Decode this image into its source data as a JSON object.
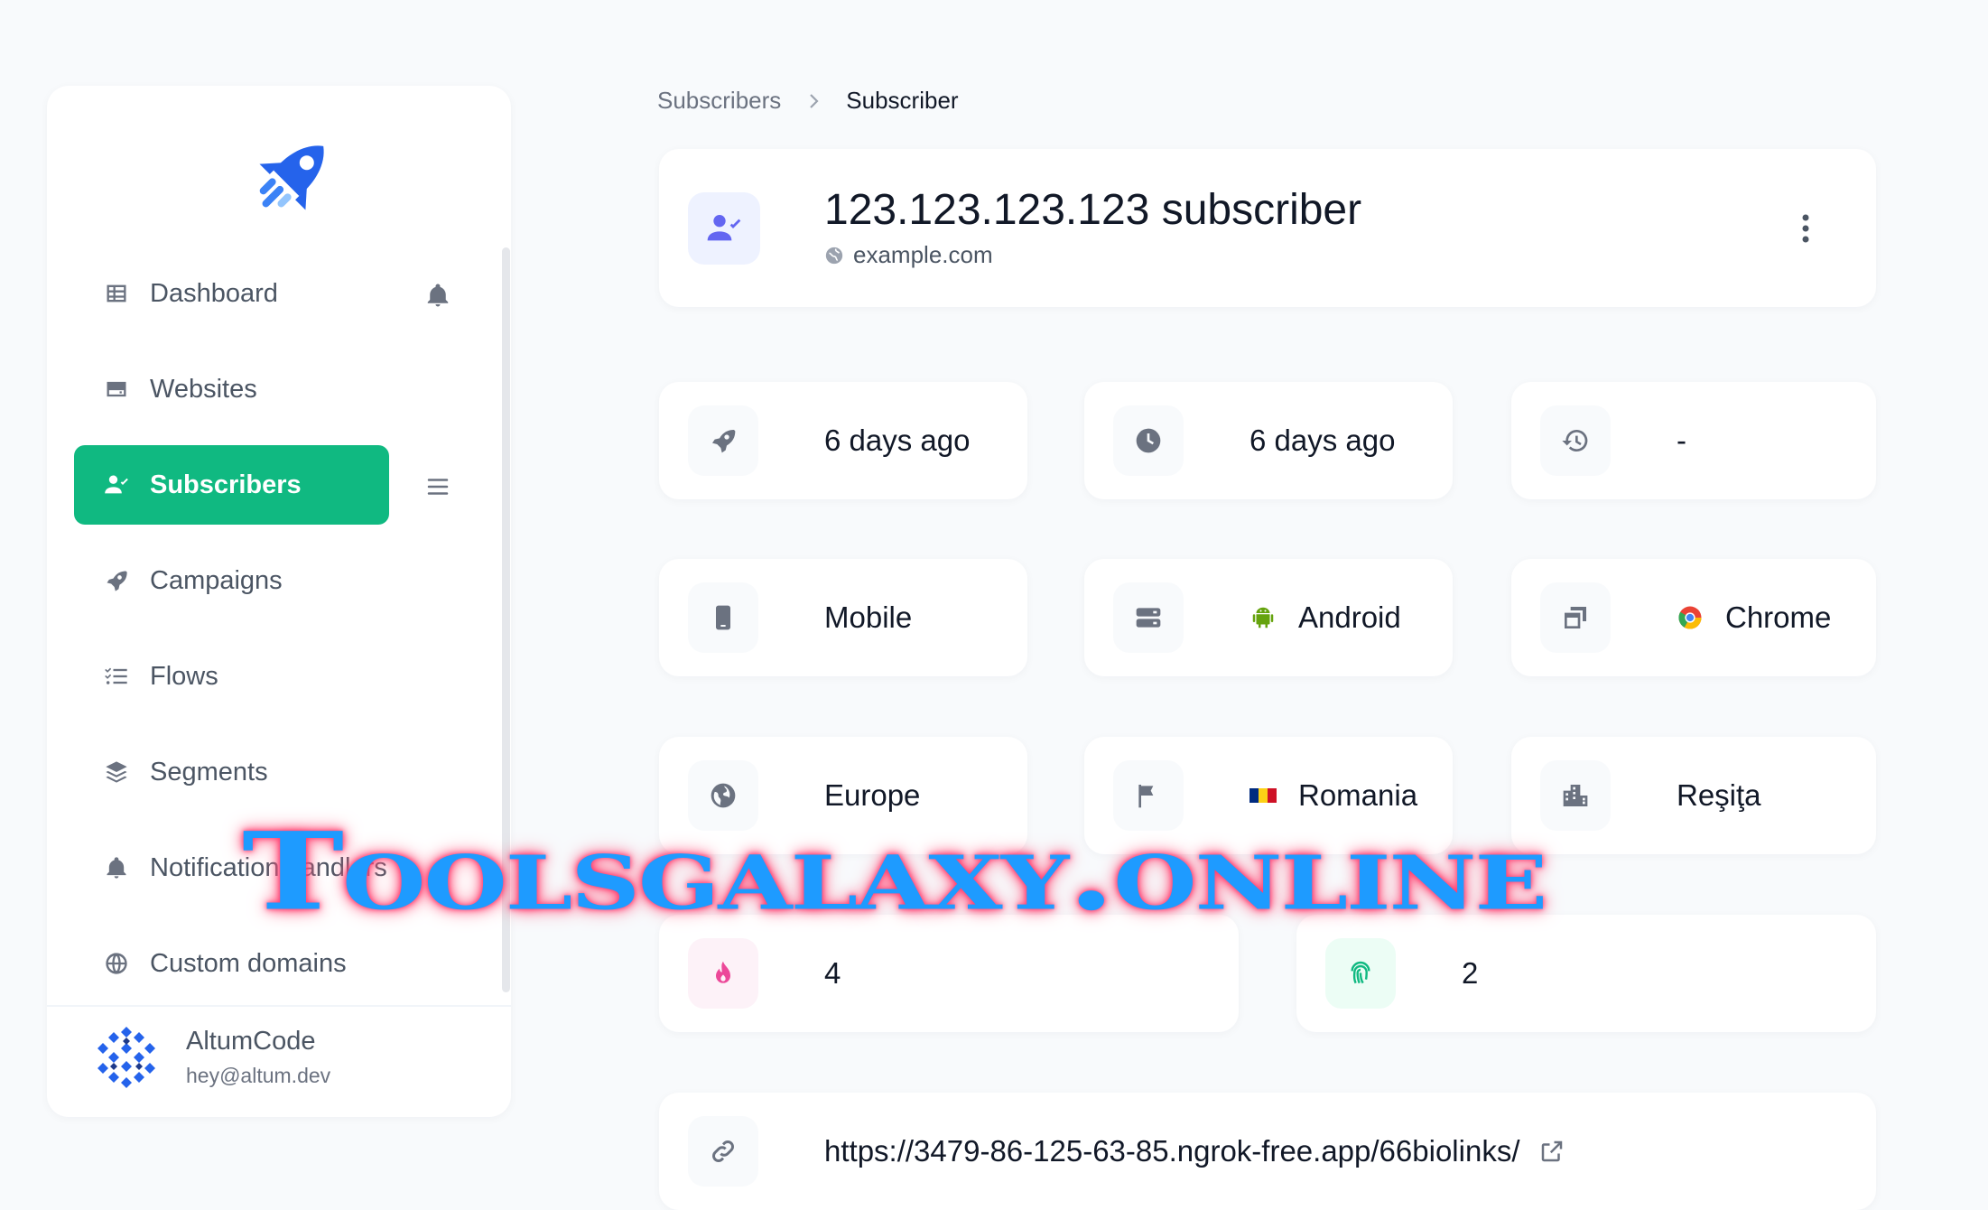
{
  "sidebar": {
    "items": [
      {
        "label": "Dashboard",
        "icon": "table-icon"
      },
      {
        "label": "Websites",
        "icon": "server-icon"
      },
      {
        "label": "Subscribers",
        "icon": "user-check-icon"
      },
      {
        "label": "Campaigns",
        "icon": "rocket-icon"
      },
      {
        "label": "Flows",
        "icon": "list-check-icon"
      },
      {
        "label": "Segments",
        "icon": "layers-icon"
      },
      {
        "label": "Notification handlers",
        "icon": "bell-icon"
      },
      {
        "label": "Custom domains",
        "icon": "globe-icon"
      }
    ],
    "active": "Subscribers",
    "user": {
      "name": "AltumCode",
      "email": "hey@altum.dev"
    }
  },
  "breadcrumb": {
    "previous": "Subscribers",
    "current": "Subscriber"
  },
  "header": {
    "title": "123.123.123.123 subscriber",
    "subtitle": "example.com",
    "icon": "user-check-icon"
  },
  "stats": {
    "subscribed": {
      "value": "6 days ago",
      "icon": "rocket-icon"
    },
    "last_seen": {
      "value": "6 days ago",
      "icon": "clock-icon"
    },
    "history": {
      "value": "-",
      "icon": "history-icon"
    },
    "device": {
      "value": "Mobile",
      "icon": "mobile-icon"
    },
    "os": {
      "value": "Android",
      "icon": "server-icon"
    },
    "browser": {
      "value": "Chrome",
      "icon": "windows-icon"
    },
    "continent": {
      "value": "Europe",
      "icon": "globe-americas-icon"
    },
    "country": {
      "value": "Romania",
      "icon": "flag-icon"
    },
    "city": {
      "value": "Reşiţa",
      "icon": "city-icon"
    },
    "notifications": {
      "value": "4",
      "icon": "fire-icon"
    },
    "clicks": {
      "value": "2",
      "icon": "fingerprint-icon"
    },
    "url": {
      "value": "https://3479-86-125-63-85.ngrok-free.app/66biolinks/",
      "icon": "link-icon"
    }
  },
  "colors": {
    "accent": "#10b981",
    "header_icon": "#6366f1",
    "fire": "#ec4899",
    "fingerprint": "#10b981"
  },
  "watermark": "Toolsgalaxy.online"
}
